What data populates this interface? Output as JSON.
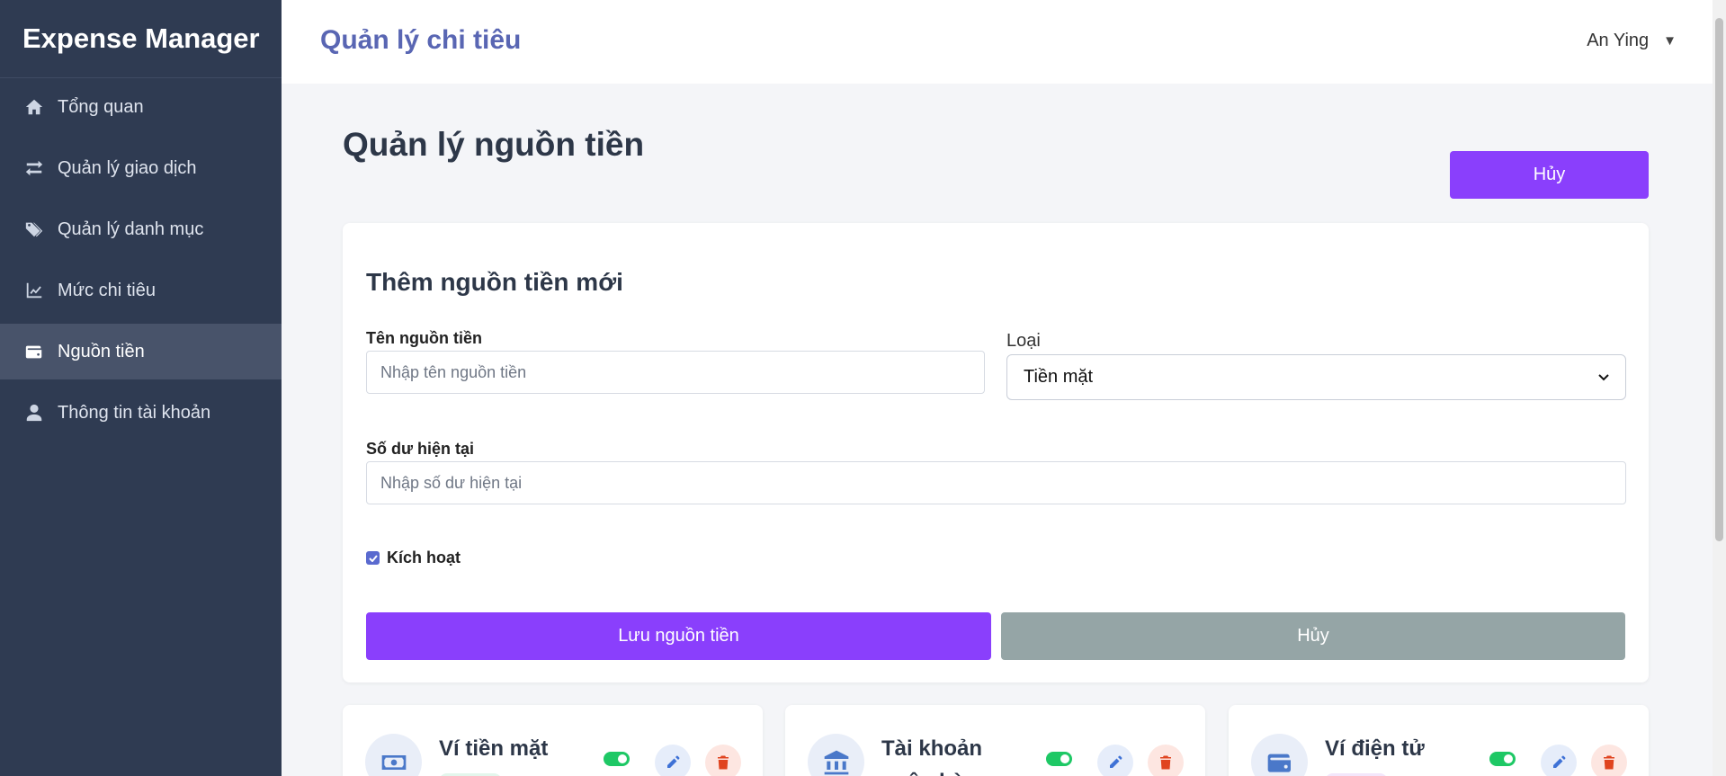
{
  "app": {
    "brand": "Expense Manager"
  },
  "sidebar": {
    "items": [
      {
        "label": "Tổng quan",
        "icon": "home-icon"
      },
      {
        "label": "Quản lý giao dịch",
        "icon": "exchange-icon"
      },
      {
        "label": "Quản lý danh mục",
        "icon": "tags-icon"
      },
      {
        "label": "Mức chi tiêu",
        "icon": "chart-line-icon"
      },
      {
        "label": "Nguồn tiền",
        "icon": "wallet-icon",
        "active": true
      },
      {
        "label": "Thông tin tài khoản",
        "icon": "user-icon"
      }
    ]
  },
  "header": {
    "title": "Quản lý chi tiêu",
    "user_name": "An Ying",
    "user_caret": "▼"
  },
  "main": {
    "page_title": "Quản lý nguồn tiền",
    "cancel_label": "Hủy"
  },
  "form": {
    "title": "Thêm nguồn tiền mới",
    "name_label": "Tên nguồn tiền",
    "name_placeholder": "Nhập tên nguồn tiền",
    "name_value": "",
    "type_label": "Loại",
    "type_selected": "Tiền mặt",
    "balance_label": "Số dư hiện tại",
    "balance_placeholder": "Nhập số dư hiện tại",
    "balance_value": "",
    "active_label": "Kích hoạt",
    "active_checked": true,
    "save_label": "Lưu nguồn tiền",
    "cancel_label": "Hủy"
  },
  "sources": [
    {
      "name": "Ví tiền mặt",
      "icon": "money-bill-icon",
      "active": true,
      "badge_color": "#e3f6ec"
    },
    {
      "name": "Tài khoản ngân hàng",
      "icon": "bank-icon",
      "active": true,
      "badge_color": "#e6edfa"
    },
    {
      "name": "Ví điện tử",
      "icon": "wallet-icon",
      "active": true,
      "badge_color": "#f3e6fb"
    }
  ],
  "colors": {
    "sidebar_bg": "#2f3b52",
    "sidebar_active": "#48536a",
    "accent": "#8a3ffc",
    "header_title": "#5966b3",
    "secondary_button": "#95a5a6",
    "toggle_on": "#1ec865",
    "danger": "#e0441f",
    "edit": "#3f72d6"
  }
}
